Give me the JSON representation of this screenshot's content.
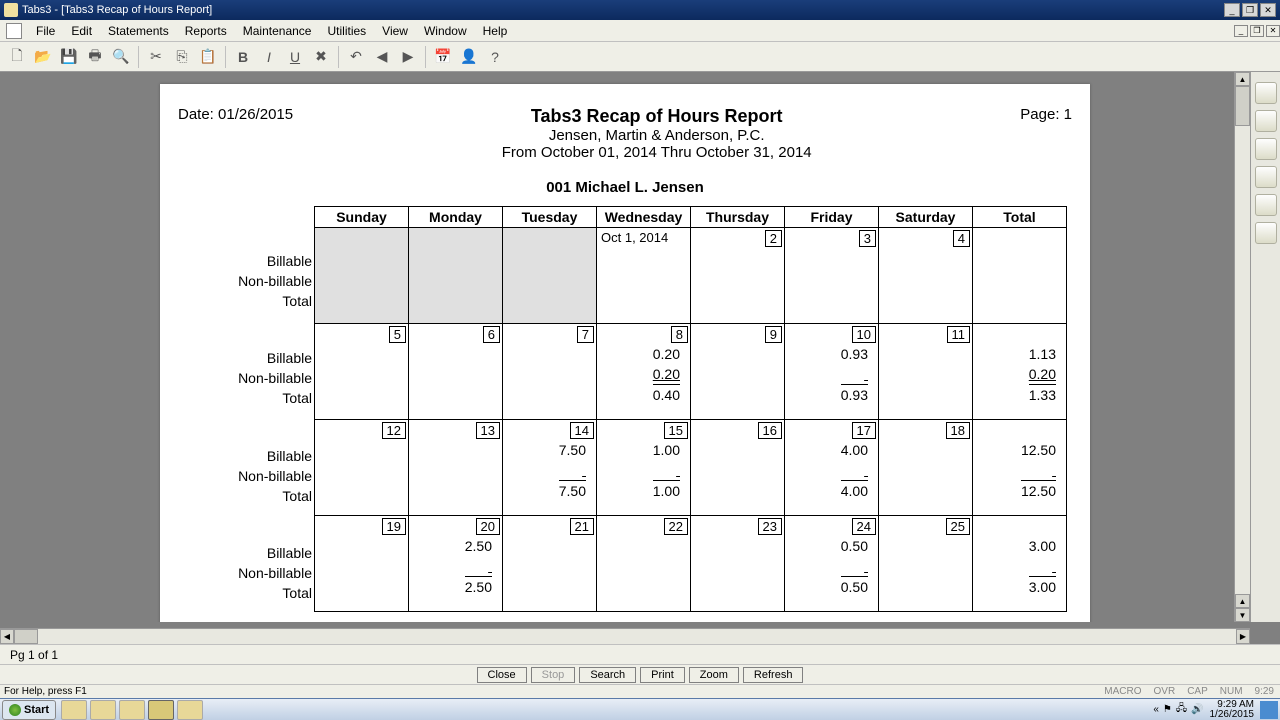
{
  "title": "Tabs3 - [Tabs3 Recap of Hours Report]",
  "menu": [
    "File",
    "Edit",
    "Statements",
    "Reports",
    "Maintenance",
    "Utilities",
    "View",
    "Window",
    "Help"
  ],
  "report": {
    "date_label": "Date: 01/26/2015",
    "title": "Tabs3 Recap of Hours Report",
    "firm": "Jensen, Martin & Anderson, P.C.",
    "range": "From October 01, 2014 Thru October 31, 2014",
    "page_label": "Page: 1",
    "employee": "001 Michael L. Jensen"
  },
  "days": [
    "Sunday",
    "Monday",
    "Tuesday",
    "Wednesday",
    "Thursday",
    "Friday",
    "Saturday",
    "Total"
  ],
  "row_labels": [
    "Billable",
    "Non-billable",
    "Total"
  ],
  "weeks": [
    {
      "cells": [
        {
          "gray": true
        },
        {
          "gray": true
        },
        {
          "gray": true
        },
        {
          "date_text": "Oct 1, 2014"
        },
        {
          "num": "2"
        },
        {
          "num": "3"
        },
        {
          "num": "4"
        },
        {
          "total": true
        }
      ]
    },
    {
      "cells": [
        {
          "num": "5"
        },
        {
          "num": "6"
        },
        {
          "num": "7"
        },
        {
          "num": "8",
          "b": "0.20",
          "nb": "0.20",
          "t": "0.40"
        },
        {
          "num": "9"
        },
        {
          "num": "10",
          "b": "0.93",
          "t": "0.93"
        },
        {
          "num": "11"
        },
        {
          "total": true,
          "b": "1.13",
          "nb": "0.20",
          "t": "1.33"
        }
      ]
    },
    {
      "cells": [
        {
          "num": "12"
        },
        {
          "num": "13"
        },
        {
          "num": "14",
          "b": "7.50",
          "t": "7.50"
        },
        {
          "num": "15",
          "b": "1.00",
          "t": "1.00"
        },
        {
          "num": "16"
        },
        {
          "num": "17",
          "b": "4.00",
          "t": "4.00"
        },
        {
          "num": "18"
        },
        {
          "total": true,
          "b": "12.50",
          "t": "12.50"
        }
      ]
    },
    {
      "cells": [
        {
          "num": "19"
        },
        {
          "num": "20",
          "b": "2.50",
          "t": "2.50"
        },
        {
          "num": "21"
        },
        {
          "num": "22"
        },
        {
          "num": "23"
        },
        {
          "num": "24",
          "b": "0.50",
          "t": "0.50"
        },
        {
          "num": "25"
        },
        {
          "total": true,
          "b": "3.00",
          "t": "3.00"
        }
      ]
    }
  ],
  "buttons": [
    "Close",
    "Stop",
    "Search",
    "Print",
    "Zoom",
    "Refresh"
  ],
  "page_of": "Pg 1 of 1",
  "status_help": "For Help, press F1",
  "status_right": [
    "MACRO",
    "OVR",
    "CAP",
    "NUM",
    "9:29"
  ],
  "clock": {
    "time": "9:29 AM",
    "date": "1/26/2015"
  }
}
